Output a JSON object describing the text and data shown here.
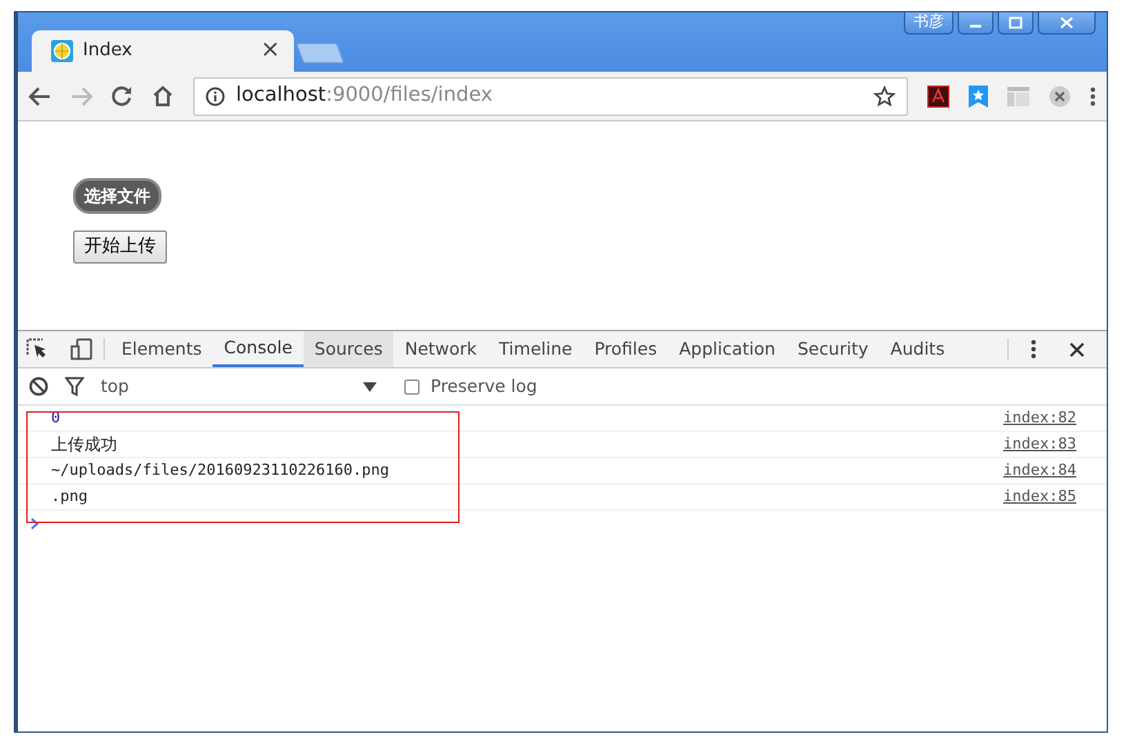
{
  "window": {
    "user": "书彦"
  },
  "tabs": [
    {
      "title": "Index",
      "close": "×"
    }
  ],
  "address": {
    "host": "localhost",
    "path": ":9000/files/index"
  },
  "page": {
    "file_button": "选择文件",
    "upload_button": "开始上传"
  },
  "devtools": {
    "tabs": [
      {
        "label": "Elements",
        "selected": false,
        "hovered": false
      },
      {
        "label": "Console",
        "selected": true,
        "hovered": false
      },
      {
        "label": "Sources",
        "selected": false,
        "hovered": true
      },
      {
        "label": "Network",
        "selected": false,
        "hovered": false
      },
      {
        "label": "Timeline",
        "selected": false,
        "hovered": false
      },
      {
        "label": "Profiles",
        "selected": false,
        "hovered": false
      },
      {
        "label": "Application",
        "selected": false,
        "hovered": false
      },
      {
        "label": "Security",
        "selected": false,
        "hovered": false
      },
      {
        "label": "Audits",
        "selected": false,
        "hovered": false
      }
    ],
    "context": "top",
    "preserve_log": {
      "label": "Preserve log",
      "checked": false
    },
    "console": [
      {
        "kind": "number",
        "text": "0",
        "source": "index:82"
      },
      {
        "kind": "string",
        "text": "上传成功",
        "source": "index:83"
      },
      {
        "kind": "string",
        "text": "~/uploads/files/20160923110226160.png",
        "source": "index:84"
      },
      {
        "kind": "string",
        "text": ".png",
        "source": "index:85"
      }
    ]
  }
}
